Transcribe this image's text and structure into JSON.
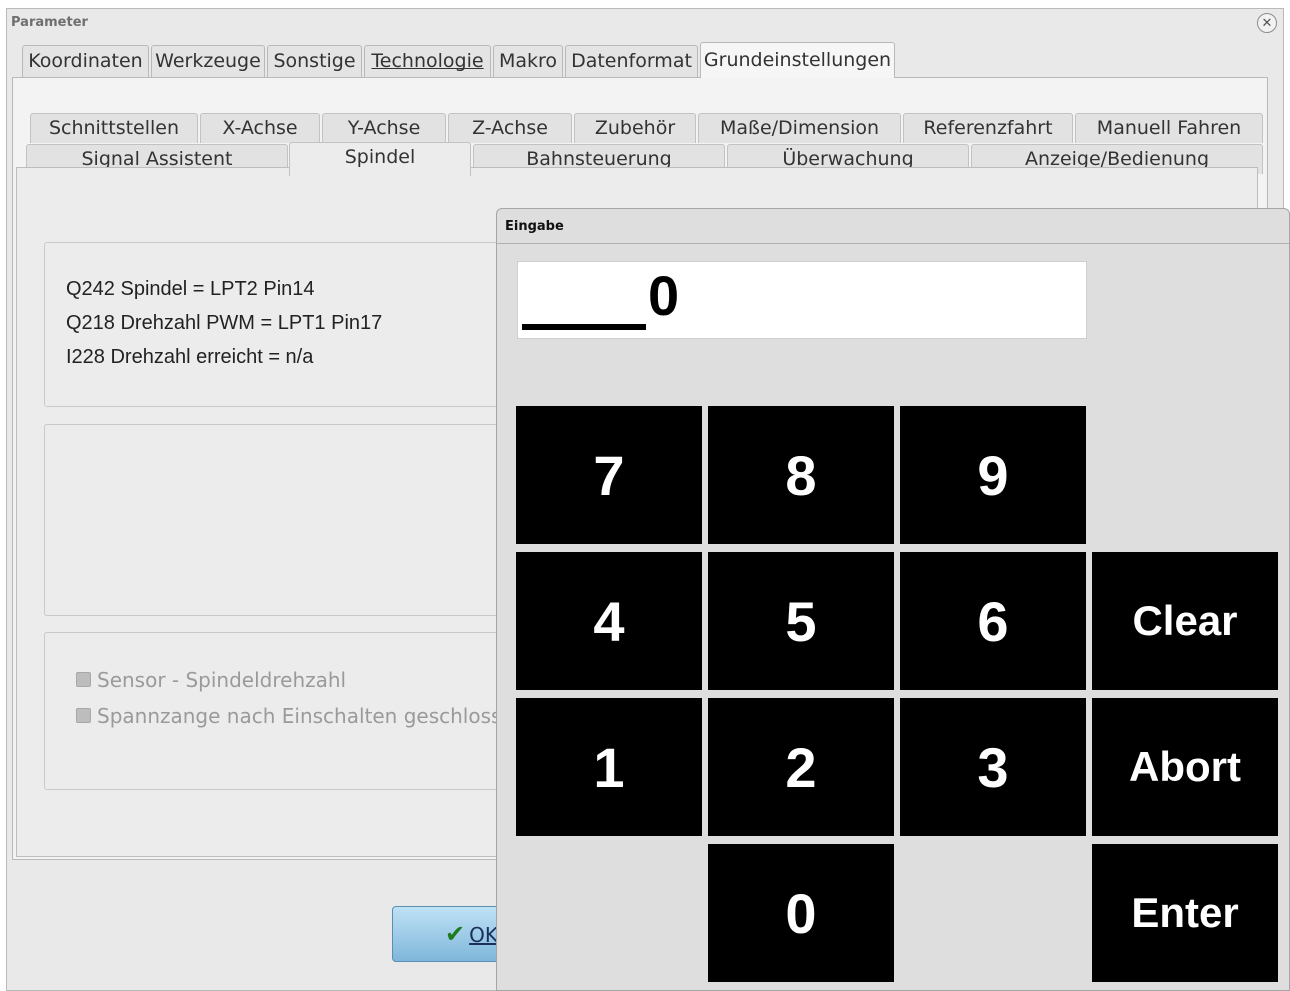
{
  "window": {
    "title": "Parameter"
  },
  "top_tabs": [
    {
      "label": "Koordinaten"
    },
    {
      "label": "Werkzeuge"
    },
    {
      "label": "Sonstige"
    },
    {
      "label": "Technologie",
      "underline": "T"
    },
    {
      "label": "Makro"
    },
    {
      "label": "Datenformat"
    },
    {
      "label": "Grundeinstellungen",
      "active": true
    }
  ],
  "sub_tabs_row1": [
    {
      "label": "Schnittstellen"
    },
    {
      "label": "X-Achse"
    },
    {
      "label": "Y-Achse"
    },
    {
      "label": "Z-Achse"
    },
    {
      "label": "Zubehör"
    },
    {
      "label": "Maße/Dimension"
    },
    {
      "label": "Referenzfahrt"
    },
    {
      "label": "Manuell Fahren"
    }
  ],
  "sub_tabs_row2": [
    {
      "label": "Signal Assistent"
    },
    {
      "label": "Spindel",
      "active": true
    },
    {
      "label": "Bahnsteuerung"
    },
    {
      "label": "Überwachung"
    },
    {
      "label": "Anzeige/Bedienung"
    }
  ],
  "signals": [
    "Q242 Spindel = LPT2 Pin14",
    "Q218 Drehzahl PWM = LPT1 Pin17",
    "I228 Drehzahl erreicht = n/a"
  ],
  "checkboxes": [
    {
      "label": "Sensor - Spindeldrehzahl",
      "checked": false,
      "enabled": false
    },
    {
      "label": "Spannzange nach Einschalten geschlossen",
      "checked": false,
      "enabled": false
    }
  ],
  "ok_button": {
    "label_visible": "OK",
    "partially_hidden": true,
    "check_glyph": "✔"
  },
  "input_dialog": {
    "title": "Eingabe",
    "value": "0",
    "keys": {
      "k7": "7",
      "k8": "8",
      "k9": "9",
      "k4": "4",
      "k5": "5",
      "k6": "6",
      "clear": "Clear",
      "k1": "1",
      "k2": "2",
      "k3": "3",
      "abort": "Abort",
      "k0": "0",
      "enter": "Enter"
    }
  },
  "icons": {
    "close": "✕",
    "ok_check": "✔"
  }
}
